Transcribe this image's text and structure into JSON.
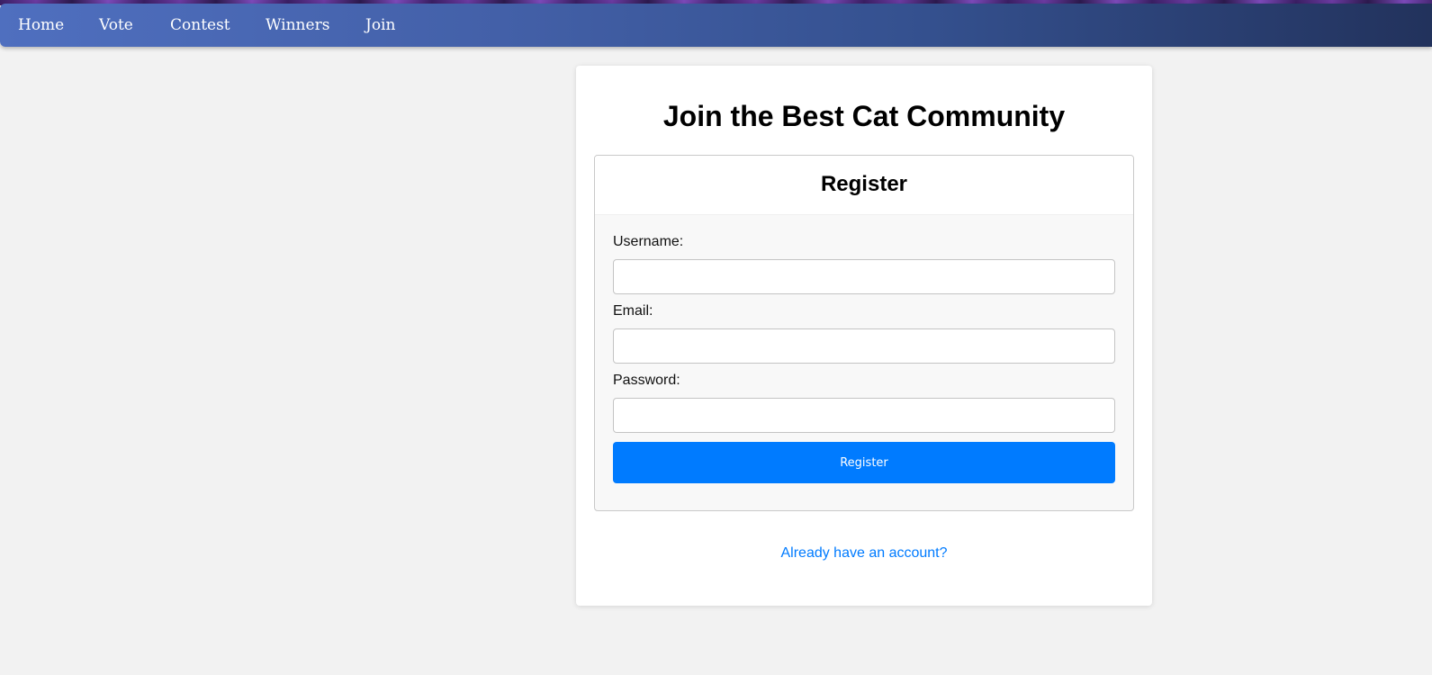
{
  "nav": {
    "items": [
      {
        "label": "Home"
      },
      {
        "label": "Vote"
      },
      {
        "label": "Contest"
      },
      {
        "label": "Winners"
      },
      {
        "label": "Join"
      }
    ]
  },
  "page": {
    "title": "Join the Best Cat Community"
  },
  "form": {
    "heading": "Register",
    "fields": {
      "username": {
        "label": "Username:",
        "value": ""
      },
      "email": {
        "label": "Email:",
        "value": ""
      },
      "password": {
        "label": "Password:",
        "value": ""
      }
    },
    "submit_label": "Register"
  },
  "login_link": "Already have an account?",
  "colors": {
    "accent": "#007bff",
    "nav_start": "#4f6fbf",
    "nav_end": "#22325c",
    "background": "#f2f2f2"
  }
}
